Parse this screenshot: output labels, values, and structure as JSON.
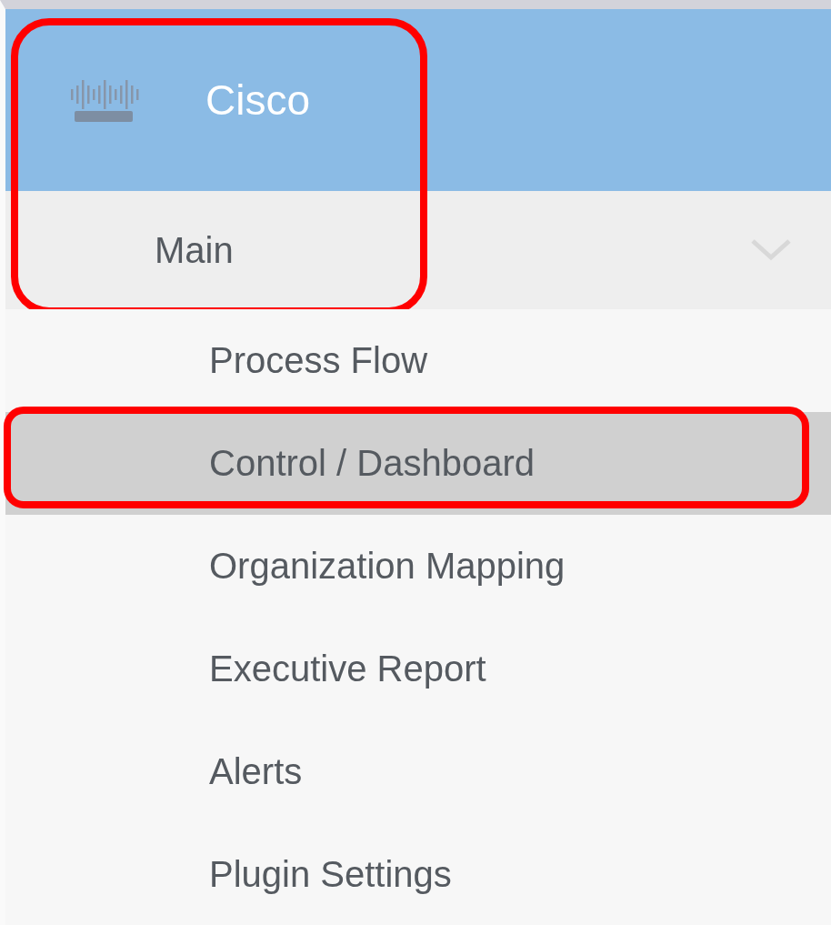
{
  "header": {
    "title": "Cisco"
  },
  "group": {
    "label": "Main",
    "expanded": true
  },
  "top_annotation": {
    "shown": true
  },
  "menu_items": [
    {
      "label": "Process Flow",
      "selected": false,
      "annotated": false
    },
    {
      "label": "Control / Dashboard",
      "selected": true,
      "annotated": true
    },
    {
      "label": "Organization Mapping",
      "selected": false,
      "annotated": false
    },
    {
      "label": "Executive Report",
      "selected": false,
      "annotated": false
    },
    {
      "label": "Alerts",
      "selected": false,
      "annotated": false
    },
    {
      "label": "Plugin Settings",
      "selected": false,
      "annotated": false
    }
  ]
}
